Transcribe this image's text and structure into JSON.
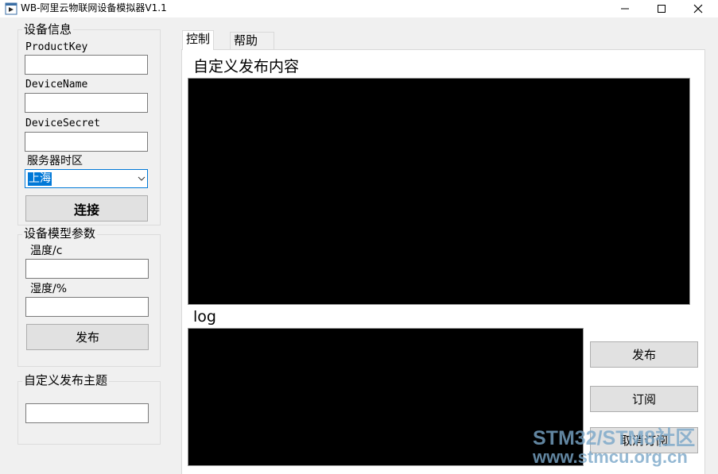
{
  "window": {
    "title": "WB-阿里云物联网设备模拟器V1.1"
  },
  "device_info": {
    "group_title": "设备信息",
    "product_key_label": "ProductKey",
    "product_key_value": "",
    "device_name_label": "DeviceName",
    "device_name_value": "",
    "device_secret_label": "DeviceSecret",
    "device_secret_value": "",
    "timezone_label": "服务器时区",
    "timezone_value": "上海",
    "connect_label": "连接"
  },
  "model_params": {
    "group_title": "设备模型参数",
    "temperature_label": "温度/c",
    "temperature_value": "",
    "humidity_label": "湿度/%",
    "humidity_value": "",
    "publish_label": "发布"
  },
  "custom_topic": {
    "group_title": "自定义发布主题",
    "topic_value": ""
  },
  "tabs": [
    {
      "label": "控制",
      "active": true
    },
    {
      "label": "帮助",
      "active": false
    }
  ],
  "control_panel": {
    "custom_content_label": "自定义发布内容",
    "log_label": "log",
    "publish_label": "发布",
    "subscribe_label": "订阅",
    "unsubscribe_label": "取消订阅"
  },
  "watermark": {
    "line1": "STM32/STM8社区",
    "line2": "www.stmcu.org.cn"
  },
  "colors": {
    "selection": "#0078d7",
    "console_bg": "#000000",
    "button_bg": "#e1e1e1",
    "window_bg": "#f0f0f0"
  }
}
